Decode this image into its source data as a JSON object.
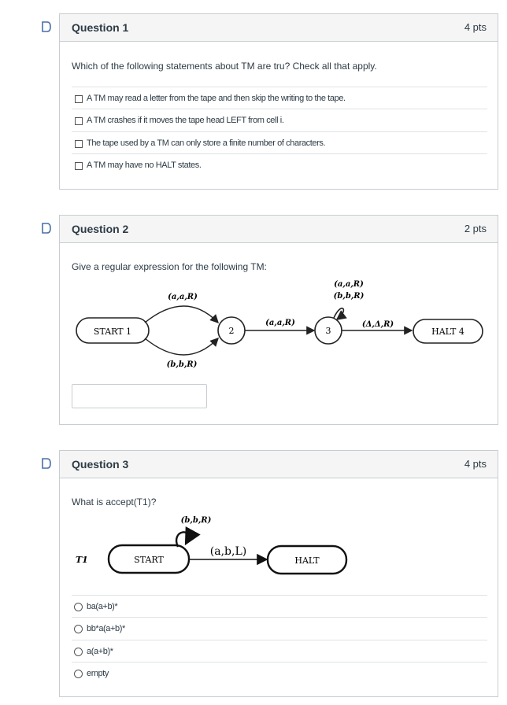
{
  "q1": {
    "title": "Question 1",
    "points": "4 pts",
    "text": "Which of the following statements about TM are tru? Check all that apply.",
    "options": [
      "A TM may read a letter from the tape and then skip the writing to the tape.",
      "A TM crashes if it moves the tape head LEFT from cell i.",
      "The tape used by a TM can only store a finite number of characters.",
      "A TM may have no HALT states."
    ]
  },
  "q2": {
    "title": "Question 2",
    "points": "2 pts",
    "text": "Give a regular expression for the following TM:",
    "answer_value": "",
    "diagram": {
      "start": "START 1",
      "s2": "2",
      "s3": "3",
      "halt": "HALT 4",
      "e_top": "(a,a,R)",
      "e_bottom": "(b,b,R)",
      "e_23": "(a,a,R)",
      "loop1": "(a,a,R)",
      "loop2": "(b,b,R)",
      "e_34": "(Δ,Δ,R)"
    }
  },
  "q3": {
    "title": "Question 3",
    "points": "4 pts",
    "text": "What is accept(T1)?",
    "diagram": {
      "name": "T1",
      "start": "START",
      "halt": "HALT",
      "loop": "(b,b,R)",
      "edge": "(a,b,L)"
    },
    "options": [
      "ba(a+b)*",
      "bb*a(a+b)*",
      "a(a+b)*",
      "empty"
    ]
  },
  "colors": {
    "flag": "#4a6ea9",
    "border": "#c7cdd1",
    "header_bg": "#f5f5f5"
  }
}
